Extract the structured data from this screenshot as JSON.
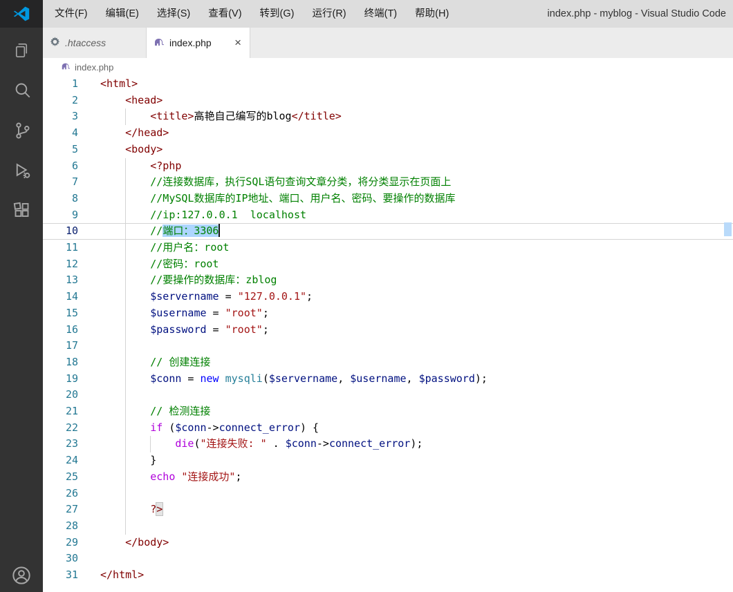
{
  "title_bar": {
    "menus": [
      "文件(F)",
      "编辑(E)",
      "选择(S)",
      "查看(V)",
      "转到(G)",
      "运行(R)",
      "终端(T)",
      "帮助(H)"
    ],
    "title": "index.php - myblog - Visual Studio Code"
  },
  "activity_bar": {
    "icons": [
      "explorer",
      "search",
      "source-control",
      "run-and-debug",
      "extensions"
    ],
    "bottom_icons": [
      "account"
    ]
  },
  "tabs": [
    {
      "label": ".htaccess",
      "icon": "gear-icon",
      "state": "preview-inactive"
    },
    {
      "label": "index.php",
      "icon": "php-elephant-icon",
      "state": "active",
      "close_glyph": "×"
    }
  ],
  "breadcrumb": {
    "file": "index.php",
    "icon": "php-elephant-icon"
  },
  "editor": {
    "current_line": 10,
    "selection_text": "端口：3306",
    "lines": [
      {
        "n": 1,
        "i": 0,
        "g": 0,
        "t": [
          [
            "tag",
            "<html>"
          ]
        ]
      },
      {
        "n": 2,
        "i": 4,
        "g": 0,
        "t": [
          [
            "tag",
            "<head>"
          ]
        ]
      },
      {
        "n": 3,
        "i": 8,
        "g": 1,
        "t": [
          [
            "tag",
            "<title>"
          ],
          [
            "text",
            "高艳自己编写的blog"
          ],
          [
            "tag",
            "</title>"
          ]
        ]
      },
      {
        "n": 4,
        "i": 4,
        "g": 0,
        "t": [
          [
            "tag",
            "</head>"
          ]
        ]
      },
      {
        "n": 5,
        "i": 4,
        "g": 0,
        "t": [
          [
            "tag",
            "<body>"
          ]
        ]
      },
      {
        "n": 6,
        "i": 8,
        "g": 1,
        "t": [
          [
            "tag",
            "<?php"
          ]
        ]
      },
      {
        "n": 7,
        "i": 8,
        "g": 1,
        "t": [
          [
            "com",
            "//连接数据库，执行SQL语句查询文章分类，将分类显示在页面上"
          ]
        ]
      },
      {
        "n": 8,
        "i": 8,
        "g": 1,
        "t": [
          [
            "com",
            "//MySQL数据库的IP地址、端口、用户名、密码、要操作的数据库"
          ]
        ]
      },
      {
        "n": 9,
        "i": 8,
        "g": 1,
        "t": [
          [
            "com",
            "//ip:127.0.0.1  localhost"
          ]
        ]
      },
      {
        "n": 10,
        "i": 8,
        "g": 1,
        "current": true,
        "cursor": true,
        "t": [
          [
            "com",
            "//"
          ],
          [
            "com",
            "端口：3306",
            "sel"
          ]
        ]
      },
      {
        "n": 11,
        "i": 8,
        "g": 1,
        "t": [
          [
            "com",
            "//用户名：root"
          ]
        ]
      },
      {
        "n": 12,
        "i": 8,
        "g": 1,
        "t": [
          [
            "com",
            "//密码：root"
          ]
        ]
      },
      {
        "n": 13,
        "i": 8,
        "g": 1,
        "t": [
          [
            "com",
            "//要操作的数据库：zblog"
          ]
        ]
      },
      {
        "n": 14,
        "i": 8,
        "g": 1,
        "t": [
          [
            "var",
            "$servername"
          ],
          [
            "pun",
            " = "
          ],
          [
            "str",
            "\"127.0.0.1\""
          ],
          [
            "pun",
            ";"
          ]
        ]
      },
      {
        "n": 15,
        "i": 8,
        "g": 1,
        "t": [
          [
            "var",
            "$username"
          ],
          [
            "pun",
            " = "
          ],
          [
            "str",
            "\"root\""
          ],
          [
            "pun",
            ";"
          ]
        ]
      },
      {
        "n": 16,
        "i": 8,
        "g": 1,
        "t": [
          [
            "var",
            "$password"
          ],
          [
            "pun",
            " = "
          ],
          [
            "str",
            "\"root\""
          ],
          [
            "pun",
            ";"
          ]
        ]
      },
      {
        "n": 17,
        "i": 0,
        "g": 1,
        "t": []
      },
      {
        "n": 18,
        "i": 8,
        "g": 1,
        "t": [
          [
            "com",
            "// 创建连接"
          ]
        ]
      },
      {
        "n": 19,
        "i": 8,
        "g": 1,
        "t": [
          [
            "var",
            "$conn"
          ],
          [
            "pun",
            " = "
          ],
          [
            "kwb",
            "new"
          ],
          [
            "pun",
            " "
          ],
          [
            "typ",
            "mysqli"
          ],
          [
            "pun",
            "("
          ],
          [
            "var",
            "$servername"
          ],
          [
            "pun",
            ", "
          ],
          [
            "var",
            "$username"
          ],
          [
            "pun",
            ", "
          ],
          [
            "var",
            "$password"
          ],
          [
            "pun",
            ");"
          ]
        ]
      },
      {
        "n": 20,
        "i": 0,
        "g": 1,
        "t": []
      },
      {
        "n": 21,
        "i": 8,
        "g": 1,
        "t": [
          [
            "com",
            "// 检测连接"
          ]
        ]
      },
      {
        "n": 22,
        "i": 8,
        "g": 1,
        "t": [
          [
            "kw",
            "if"
          ],
          [
            "pun",
            " ("
          ],
          [
            "var",
            "$conn"
          ],
          [
            "pun",
            "->"
          ],
          [
            "var",
            "connect_error"
          ],
          [
            "pun",
            ") {"
          ]
        ]
      },
      {
        "n": 23,
        "i": 12,
        "g": 2,
        "t": [
          [
            "kw",
            "die"
          ],
          [
            "pun",
            "("
          ],
          [
            "str",
            "\"连接失败: \""
          ],
          [
            "pun",
            " . "
          ],
          [
            "var",
            "$conn"
          ],
          [
            "pun",
            "->"
          ],
          [
            "var",
            "connect_error"
          ],
          [
            "pun",
            ");"
          ]
        ]
      },
      {
        "n": 24,
        "i": 8,
        "g": 1,
        "t": [
          [
            "pun",
            "}"
          ]
        ]
      },
      {
        "n": 25,
        "i": 8,
        "g": 1,
        "t": [
          [
            "kw",
            "echo"
          ],
          [
            "pun",
            " "
          ],
          [
            "str",
            "\"连接成功\""
          ],
          [
            "pun",
            ";"
          ]
        ]
      },
      {
        "n": 26,
        "i": 0,
        "g": 1,
        "t": []
      },
      {
        "n": 27,
        "i": 8,
        "g": 1,
        "t": [
          [
            "tag",
            "?"
          ],
          [
            "tagm",
            ">"
          ]
        ]
      },
      {
        "n": 28,
        "i": 0,
        "g": 1,
        "t": []
      },
      {
        "n": 29,
        "i": 4,
        "g": 0,
        "t": [
          [
            "tag",
            "</body>"
          ]
        ]
      },
      {
        "n": 30,
        "i": 0,
        "g": 0,
        "t": []
      },
      {
        "n": 31,
        "i": 0,
        "g": 0,
        "t": [
          [
            "tag",
            "</html>"
          ]
        ]
      }
    ]
  },
  "colors": {
    "accent_blue": "#007acc",
    "titlebar_bg": "#dddddd",
    "activitybar_bg": "#333333",
    "editor_bg": "#ffffff",
    "selection_bg": "#add6ff",
    "comment_green": "#008000",
    "tag_maroon": "#800000",
    "string_red": "#a31515",
    "variable_blue": "#001080",
    "keyword_purple": "#af00db",
    "keyword_blue": "#0000ff",
    "class_teal": "#267f99",
    "line_number": "#237893",
    "active_line_number": "#0b216f",
    "php_icon_purple": "#7e71b2"
  }
}
